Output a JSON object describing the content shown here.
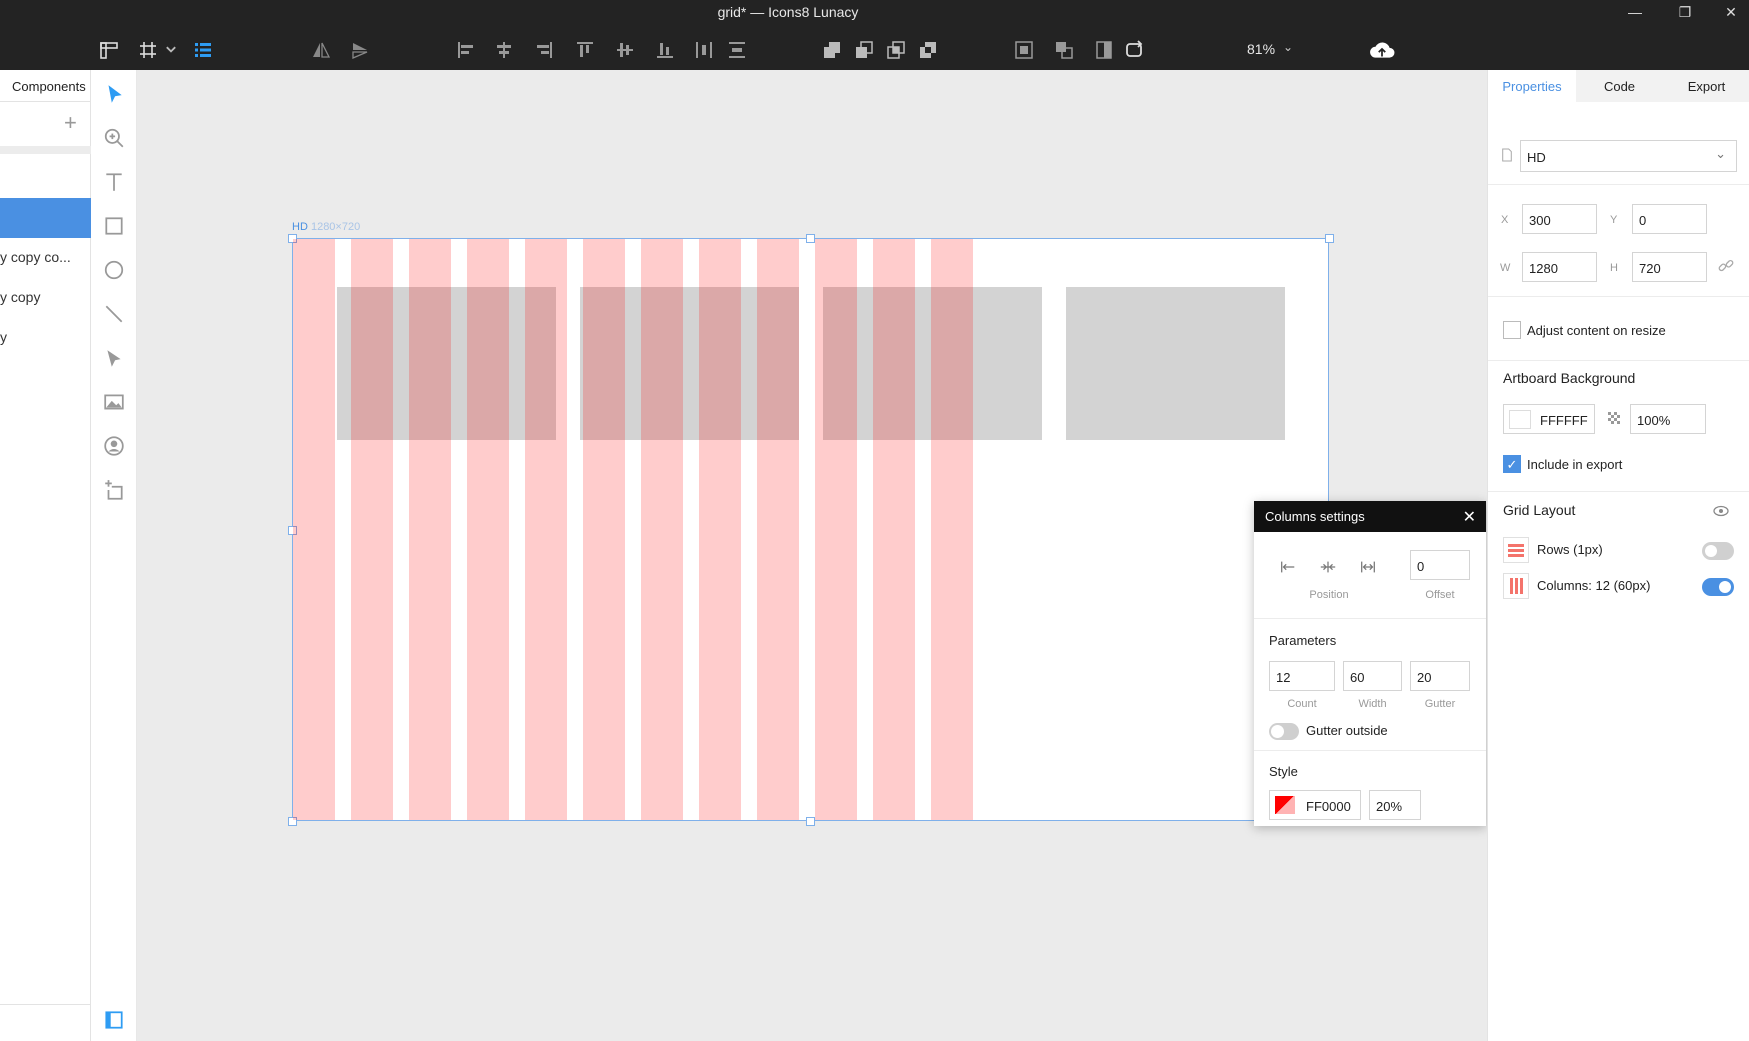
{
  "window": {
    "title": "grid* — Icons8 Lunacy",
    "minimize": "—",
    "restore": "❐",
    "close": "✕"
  },
  "toolbar": {
    "zoom": "81%",
    "zoom_caret": "⌄",
    "icons": [
      "ruler-icon",
      "grid-icon",
      "grid-dropdown-icon",
      "layout-grid-icon",
      "flip-horizontal-icon",
      "flip-vertical-icon",
      "align-left-icon",
      "align-center-icon",
      "align-right-icon",
      "align-top-icon",
      "align-middle-icon",
      "align-bottom-icon",
      "distribute-horizontal-icon",
      "distribute-vertical-icon",
      "union-icon",
      "subtract-icon",
      "intersect-icon",
      "difference-icon",
      "mask-icon",
      "crop-icon",
      "flatten-icon",
      "rotate-icon",
      "cloud-upload-icon"
    ]
  },
  "layers_panel": {
    "tab": "Components",
    "add": "+",
    "items": [
      {
        "label": "",
        "selected": true
      },
      {
        "label": "y copy co...",
        "selected": false
      },
      {
        "label": "y copy",
        "selected": false
      },
      {
        "label": "y",
        "selected": false
      }
    ]
  },
  "tools": [
    "select-arrow-icon",
    "zoom-icon",
    "text-icon",
    "rectangle-icon",
    "oval-icon",
    "line-icon",
    "pen-icon",
    "image-icon",
    "avatar-icon",
    "artboard-icon"
  ],
  "canvas": {
    "artboard": {
      "name": "HD",
      "dims": "1280×720"
    },
    "grid": {
      "count": 12,
      "shown_columns": 12,
      "color": "#FF0000",
      "opacity": 0.2
    },
    "boxes": 4
  },
  "columns_popup": {
    "title": "Columns settings",
    "close": "✕",
    "position_label": "Position",
    "offset_value": "0",
    "offset_label": "Offset",
    "parameters_title": "Parameters",
    "count_value": "12",
    "count_label": "Count",
    "width_value": "60",
    "width_label": "Width",
    "gutter_value": "20",
    "gutter_label": "Gutter",
    "gutter_outside_label": "Gutter outside",
    "gutter_outside_on": false,
    "style_title": "Style",
    "color_value": "FF0000",
    "opacity_value": "20%"
  },
  "properties": {
    "tabs": [
      {
        "label": "Properties",
        "active": true
      },
      {
        "label": "Code",
        "active": false
      },
      {
        "label": "Export",
        "active": false
      }
    ],
    "preset": "HD",
    "preset_caret": "⌄",
    "x_label": "X",
    "x_value": "300",
    "y_label": "Y",
    "y_value": "0",
    "w_label": "W",
    "w_value": "1280",
    "h_label": "H",
    "h_value": "720",
    "adjust_label": "Adjust content on resize",
    "adjust_checked": false,
    "bg_title": "Artboard Background",
    "bg_color": "FFFFFF",
    "bg_opacity": "100%",
    "include_label": "Include in export",
    "include_checked": true,
    "include_check_mark": "✓",
    "grid_layout_title": "Grid Layout",
    "rows_label": "Rows (1px)",
    "rows_on": false,
    "columns_label": "Columns: 12 (60px)",
    "columns_on": true,
    "accent": "#4a90e2"
  }
}
